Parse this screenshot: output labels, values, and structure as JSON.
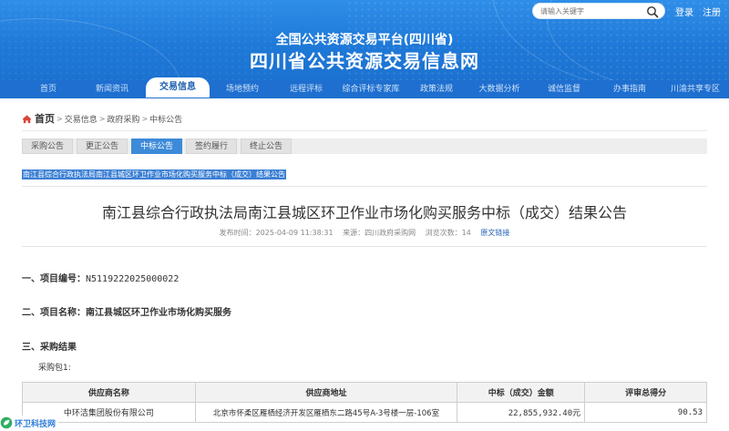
{
  "header": {
    "subtitle": "全国公共资源交易平台(四川省)",
    "title": "四川省公共资源交易信息网",
    "search_placeholder": "请输入关键字",
    "login": "登录",
    "register": "注册"
  },
  "nav": {
    "items": [
      {
        "label": "首页"
      },
      {
        "label": "新闻资讯"
      },
      {
        "label": "交易信息",
        "active": true
      },
      {
        "label": "场地预约"
      },
      {
        "label": "远程评标"
      },
      {
        "label": "综合评标专家库"
      },
      {
        "label": "政策法规"
      },
      {
        "label": "大数据分析"
      },
      {
        "label": "诚信监督"
      },
      {
        "label": "办事指南"
      },
      {
        "label": "川渝共享专区"
      }
    ]
  },
  "breadcrumb": {
    "home": "首页",
    "items": [
      "交易信息",
      "政府采购",
      "中标公告"
    ]
  },
  "tabs": [
    {
      "label": "采购公告"
    },
    {
      "label": "更正公告"
    },
    {
      "label": "中标公告",
      "active": true
    },
    {
      "label": "签约履行"
    },
    {
      "label": "终止公告"
    }
  ],
  "selected_title": "南江县综合行政执法局南江县城区环卫作业市场化购买服务中标（成交）结果公告",
  "article": {
    "title": "南江县综合行政执法局南江县城区环卫作业市场化购买服务中标（成交）结果公告",
    "publish_time": "发布时间：2025-04-09 11:38:31",
    "source": "来源：四川政府采购网",
    "views": "浏览次数：14",
    "original_link": "原文链接",
    "sections": {
      "project_no_label": "一、项目编号：",
      "project_no_value": "N5119222025000022",
      "project_name_label": "二、项目名称：",
      "project_name_value": "南江县城区环卫作业市场化购买服务",
      "result_label": "三、采购结果"
    },
    "package": "采购包1:",
    "table": {
      "headers": [
        "供应商名称",
        "供应商地址",
        "中标（成交）金额",
        "评审总得分"
      ],
      "rows": [
        [
          "中环洁集团股份有限公司",
          "北京市怀柔区雁栖经济开发区雁栖东二路45号A-3号楼一层-106室",
          "22,855,932.40元",
          "90.53"
        ]
      ]
    }
  },
  "watermark": "环卫科技网",
  "colors": {
    "header_blue": "#1f79d8",
    "nav_blue": "#1e6fcf",
    "tab_active": "#3d8ad9",
    "link": "#1f5fb5"
  }
}
